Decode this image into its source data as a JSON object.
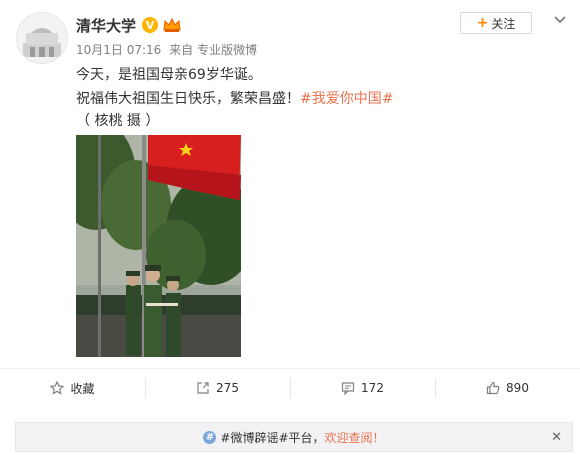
{
  "colors": {
    "accent_orange": "#ff8200",
    "hashtag": "#eb7350",
    "meta_gray": "#808080",
    "vip_badge": "#ffb400"
  },
  "post": {
    "user_name": "清华大学",
    "badges": [
      "verified-v-icon",
      "crown-member-icon"
    ],
    "follow_label": "关注",
    "time": "10月1日 07:16",
    "source_prefix": "来自",
    "source": "专业版微博",
    "line1": "今天，是祖国母亲69岁华诞。",
    "line2_text": "祝福伟大祖国生日快乐，繁荣昌盛！",
    "line2_hashtag": "#我爱你中国#",
    "line3": "（ 核桃 摄 ）",
    "image": "photo of flag-raising ceremony"
  },
  "actions": [
    {
      "icon": "star-icon",
      "label": "收藏"
    },
    {
      "icon": "share-icon",
      "label": "275"
    },
    {
      "icon": "comment-icon",
      "label": "172"
    },
    {
      "icon": "like-icon",
      "label": "890"
    }
  ],
  "notice": {
    "text": "#微博辟谣#平台，",
    "link": "欢迎查阅！"
  }
}
